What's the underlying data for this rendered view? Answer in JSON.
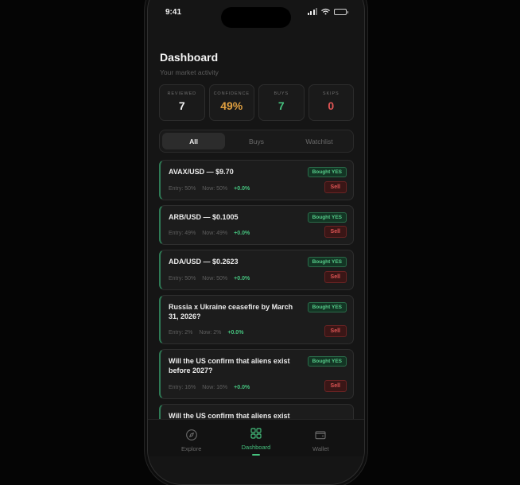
{
  "status_bar": {
    "time": "9:41",
    "battery_level": 0.8
  },
  "header": {
    "title": "Dashboard",
    "subtitle": "Your market activity"
  },
  "stats": [
    {
      "label": "REVIEWED",
      "value": "7",
      "color": "#f2f2f2"
    },
    {
      "label": "CONFIDENCE",
      "value": "49%",
      "color": "#e0a040"
    },
    {
      "label": "BUYS",
      "value": "7",
      "color": "#45c27e"
    },
    {
      "label": "SKIPS",
      "value": "0",
      "color": "#e05555"
    }
  ],
  "tabs": [
    {
      "label": "All",
      "active": true
    },
    {
      "label": "Buys",
      "active": false
    },
    {
      "label": "Watchlist",
      "active": false
    }
  ],
  "positions": [
    {
      "title": "AVAX/USD — $9.70",
      "entry": "Entry: 50%",
      "now": "Now: 50%",
      "change": "+0.0%",
      "badge": "Bought YES",
      "action": "Sell"
    },
    {
      "title": "ARB/USD — $0.1005",
      "entry": "Entry: 49%",
      "now": "Now: 49%",
      "change": "+0.0%",
      "badge": "Bought YES",
      "action": "Sell"
    },
    {
      "title": "ADA/USD — $0.2623",
      "entry": "Entry: 50%",
      "now": "Now: 50%",
      "change": "+0.0%",
      "badge": "Bought YES",
      "action": "Sell"
    },
    {
      "title": "Russia x Ukraine ceasefire by March 31, 2026?",
      "entry": "Entry: 2%",
      "now": "Now: 2%",
      "change": "+0.0%",
      "badge": "Bought YES",
      "action": "Sell"
    },
    {
      "title": "Will the US confirm that aliens exist before 2027?",
      "entry": "Entry: 16%",
      "now": "Now: 16%",
      "change": "+0.0%",
      "badge": "Bought YES",
      "action": "Sell"
    },
    {
      "title": "Will the US confirm that aliens exist",
      "entry": "",
      "now": "",
      "change": "",
      "badge": "",
      "action": ""
    }
  ],
  "nav": [
    {
      "label": "Explore",
      "icon": "compass-icon",
      "active": false
    },
    {
      "label": "Dashboard",
      "icon": "grid-icon",
      "active": true
    },
    {
      "label": "Wallet",
      "icon": "wallet-icon",
      "active": false
    }
  ],
  "colors": {
    "accent": "#45c27e",
    "danger": "#e05555",
    "warning": "#e0a040"
  }
}
